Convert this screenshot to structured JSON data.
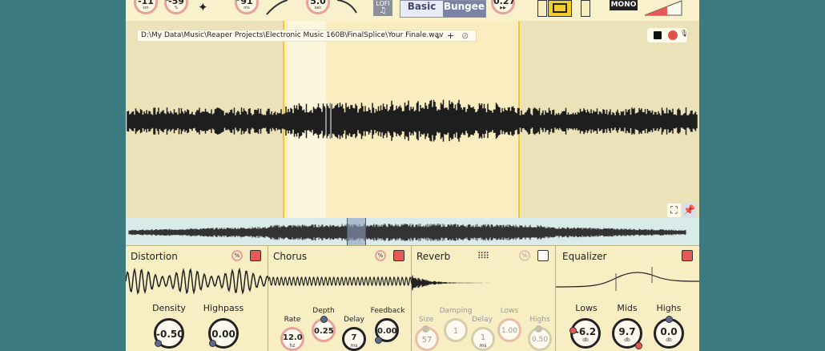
{
  "toolbar": {
    "knobs": [
      {
        "value": "-11",
        "unit": "sm"
      },
      {
        "value": "-59",
        "unit": "%"
      },
      {
        "value": "91",
        "unit": "ms"
      },
      {
        "value": "5.0",
        "unit": "sec"
      },
      {
        "value": "0.27",
        "unit": "▶▶"
      }
    ],
    "lofi_label": "LOFI",
    "modes": [
      "Basic",
      "Bungee"
    ],
    "active_mode": "Bungee",
    "mono_label": "MONO"
  },
  "waveform": {
    "file_path": "D:\\My Data\\Music\\Reaper Projects\\Electronic Music 160B\\FinalSplice\\Your Finale.wav"
  },
  "effects": {
    "distortion": {
      "title": "Distortion",
      "enabled": true,
      "params": [
        {
          "label": "Density",
          "value": "-0.50"
        },
        {
          "label": "Highpass",
          "value": "0.00"
        }
      ]
    },
    "chorus": {
      "title": "Chorus",
      "enabled": true,
      "params": [
        {
          "label": "Rate",
          "value": "12.0",
          "unit": "hz"
        },
        {
          "label": "Depth",
          "value": "0.25"
        },
        {
          "label": "Delay",
          "value": "7",
          "unit": "ms"
        },
        {
          "label": "Feedback",
          "value": "0.00"
        }
      ]
    },
    "reverb": {
      "title": "Reverb",
      "enabled": false,
      "params": [
        {
          "label": "Size",
          "value": "57"
        },
        {
          "label": "Damping",
          "value": "1"
        },
        {
          "label": "Delay",
          "value": "1",
          "unit": "ms"
        },
        {
          "label": "Lows",
          "value": "1.00"
        },
        {
          "label": "Highs",
          "value": "0.50"
        }
      ]
    },
    "equalizer": {
      "title": "Equalizer",
      "enabled": true,
      "params": [
        {
          "label": "Lows",
          "value": "-6.2",
          "unit": "db"
        },
        {
          "label": "Mids",
          "value": "9.7",
          "unit": "db"
        },
        {
          "label": "Highs",
          "value": "0.0",
          "unit": "db"
        }
      ]
    }
  },
  "colors": {
    "background": "#3b7a81",
    "panel": "#f6eec0",
    "selection": "#f1c830",
    "enabled": "#e55a56",
    "mode_active": "#7a82a6"
  }
}
